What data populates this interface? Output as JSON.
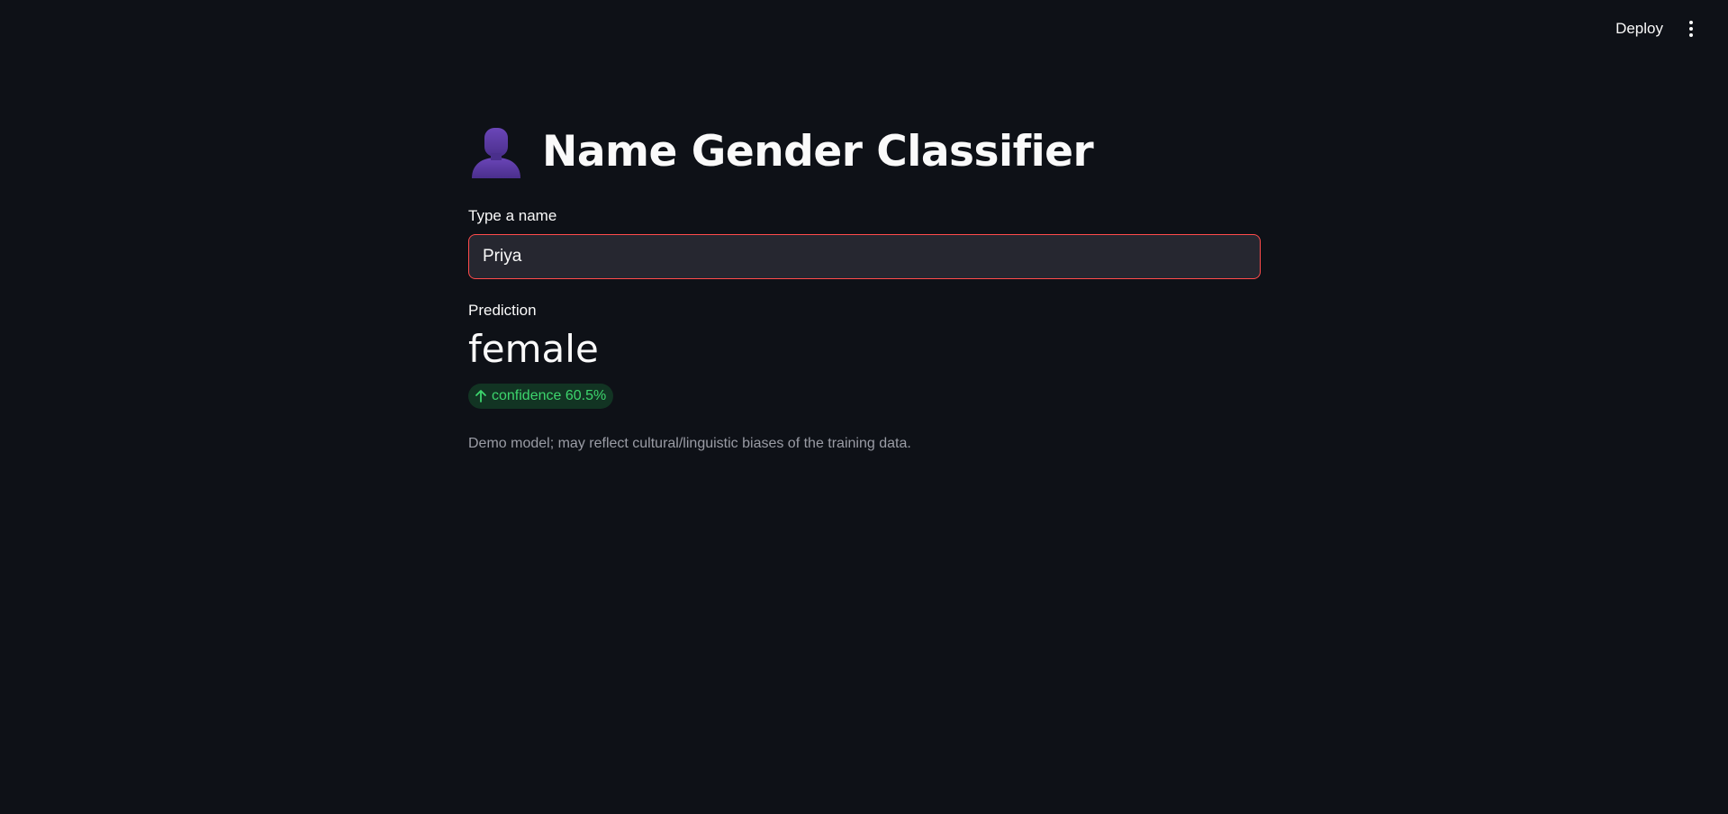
{
  "header": {
    "deploy_label": "Deploy",
    "menu_icon": "vertical-ellipsis-icon"
  },
  "app": {
    "icon": "bust-in-silhouette-icon",
    "title": "Name Gender Classifier"
  },
  "name_input": {
    "label": "Type a name",
    "value": "Priya"
  },
  "prediction": {
    "label": "Prediction",
    "value": "female",
    "delta_icon": "arrow-up-icon",
    "delta_text": "confidence 60.5%"
  },
  "caption": "Demo model; may reflect cultural/linguistic biases of the training data.",
  "colors": {
    "background": "#0e1117",
    "input_border": "#ff4b4b",
    "delta_green": "#3dd56d",
    "icon_purple": "#5b3a9e"
  }
}
